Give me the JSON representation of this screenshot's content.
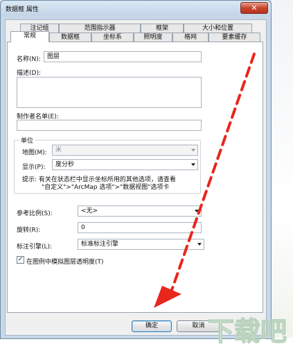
{
  "window": {
    "title": "数据框 属性",
    "close_glyph": "✕"
  },
  "tabs_back": [
    "注记组",
    "范围指示器",
    "框架",
    "大小和位置"
  ],
  "tabs_front": [
    "常规",
    "数据框",
    "坐标系",
    "照明度",
    "格网",
    "要素缓存"
  ],
  "general": {
    "name_label": "名称(N):",
    "name_value": "图层",
    "description_label": "描述(D):",
    "credits_label": "制作者名单(E):",
    "units_group_label": "单位",
    "map_units_label": "地图(M):",
    "map_units_value": "米",
    "display_units_label": "显示(P):",
    "display_units_value": "度分秒",
    "hint_line1": "提示: 有关在状态栏中显示坐标所用的其他选项，请查看",
    "hint_line2": "\"自定义\">\"ArcMap 选项\">\"数据视图\"选项卡",
    "ref_scale_label": "参考比例(S):",
    "ref_scale_value": "<无>",
    "rotation_label": "旋转(R):",
    "rotation_value": "0",
    "label_engine_label": "标注引擎(L):",
    "label_engine_value": "标准标注引擎",
    "simulate_transparency_label": "在图例中模拟图层透明度(T)",
    "simulate_transparency_checked": "✓"
  },
  "buttons": {
    "ok": "确定",
    "cancel": "取消"
  },
  "watermark": {
    "text": "下载吧"
  },
  "colors": {
    "arrow": "#e8261c",
    "accent": "#3c7fb1"
  }
}
